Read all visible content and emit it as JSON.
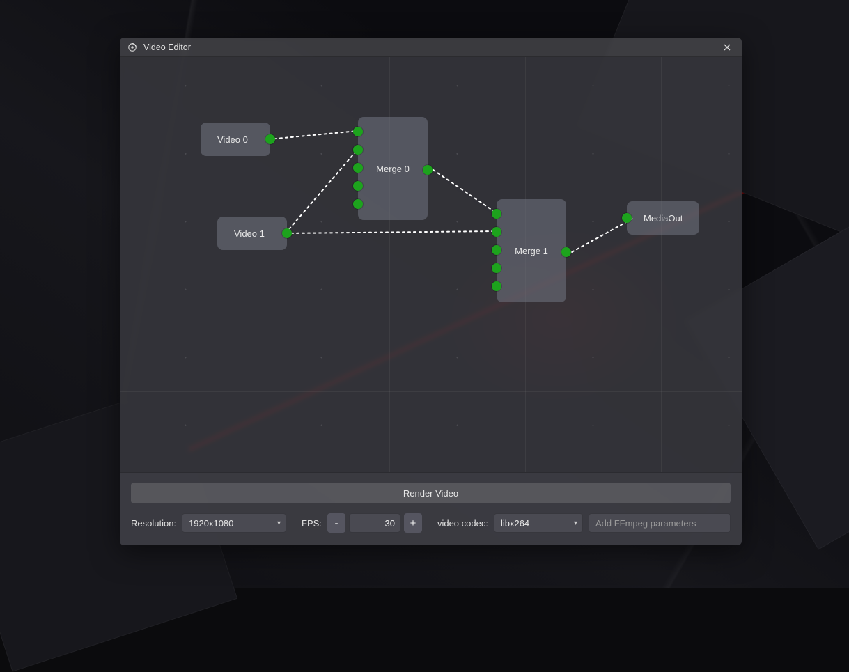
{
  "window": {
    "title": "Video Editor"
  },
  "nodes": {
    "video0": {
      "label": "Video 0"
    },
    "video1": {
      "label": "Video 1"
    },
    "merge0": {
      "label": "Merge 0"
    },
    "merge1": {
      "label": "Merge 1"
    },
    "media_out": {
      "label": "MediaOut"
    }
  },
  "footer": {
    "render_label": "Render Video",
    "resolution_label": "Resolution:",
    "resolution_value": "1920x1080",
    "fps_label": "FPS:",
    "fps_value": "30",
    "minus": "-",
    "plus": "+",
    "codec_label": "video codec:",
    "codec_value": "libx264",
    "ffmpeg_placeholder": "Add FFmpeg parameters"
  }
}
